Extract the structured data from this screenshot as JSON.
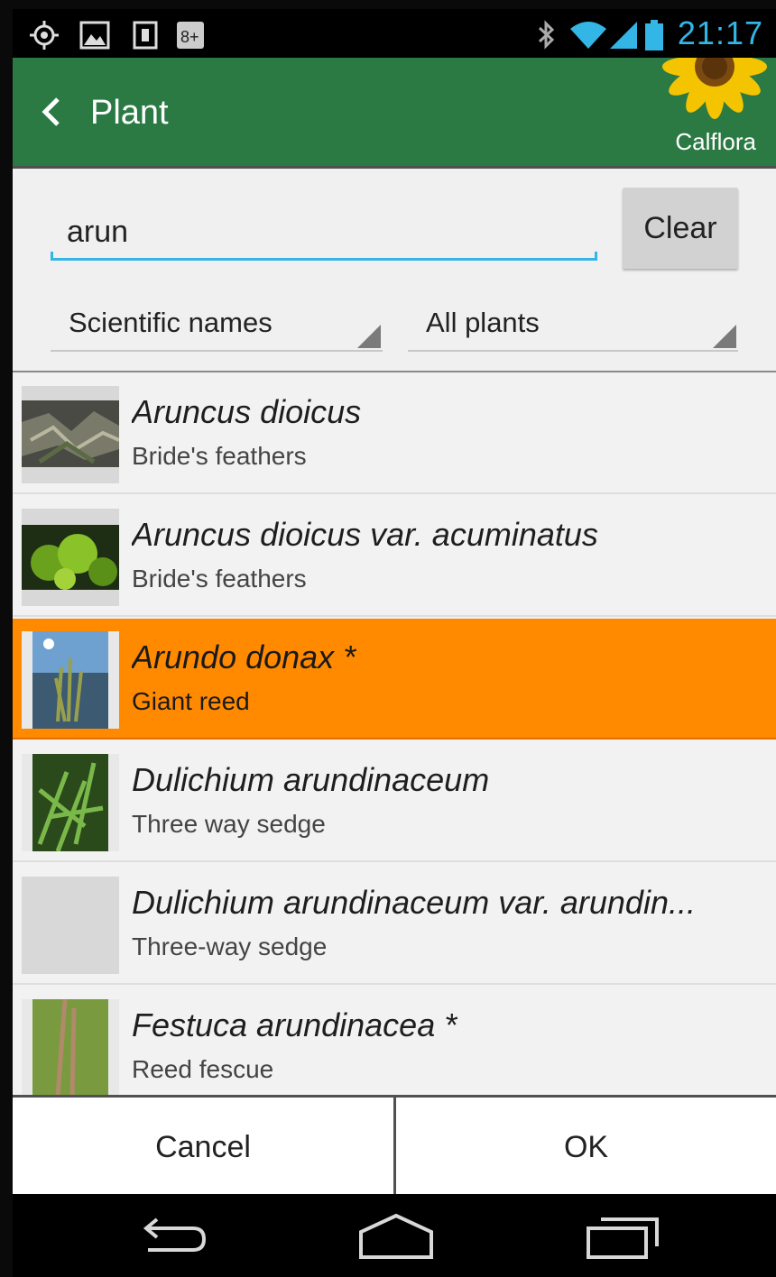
{
  "status_bar": {
    "time": "21:17",
    "left_icons": [
      "gps-icon",
      "image-icon",
      "sd-card-icon",
      "google-plus-icon"
    ],
    "right_icons": [
      "bluetooth-icon",
      "wifi-icon",
      "signal-icon",
      "battery-icon"
    ]
  },
  "action_bar": {
    "title": "Plant",
    "logo_text": "Calflora",
    "bg_color": "#2b7a44"
  },
  "search": {
    "value": "arun",
    "clear_label": "Clear"
  },
  "filters": {
    "name_type": "Scientific names",
    "plant_set": "All plants"
  },
  "results": [
    {
      "scientific": "Aruncus dioicus",
      "common": "Bride's feathers",
      "has_photo": true
    },
    {
      "scientific": "Aruncus dioicus var. acuminatus",
      "common": "Bride's feathers",
      "has_photo": true
    },
    {
      "scientific": "Arundo donax *",
      "common": "Giant reed",
      "has_photo": true,
      "selected": true
    },
    {
      "scientific": "Dulichium arundinaceum",
      "common": "Three way sedge",
      "has_photo": true
    },
    {
      "scientific": "Dulichium arundinaceum var. arundin...",
      "common": "Three-way sedge",
      "has_photo": false
    },
    {
      "scientific": "Festuca arundinacea *",
      "common": "Reed fescue",
      "has_photo": true
    }
  ],
  "dialog_buttons": {
    "cancel": "Cancel",
    "ok": "OK"
  },
  "colors": {
    "accent": "#33b5e5",
    "selected": "#ff8a00"
  }
}
